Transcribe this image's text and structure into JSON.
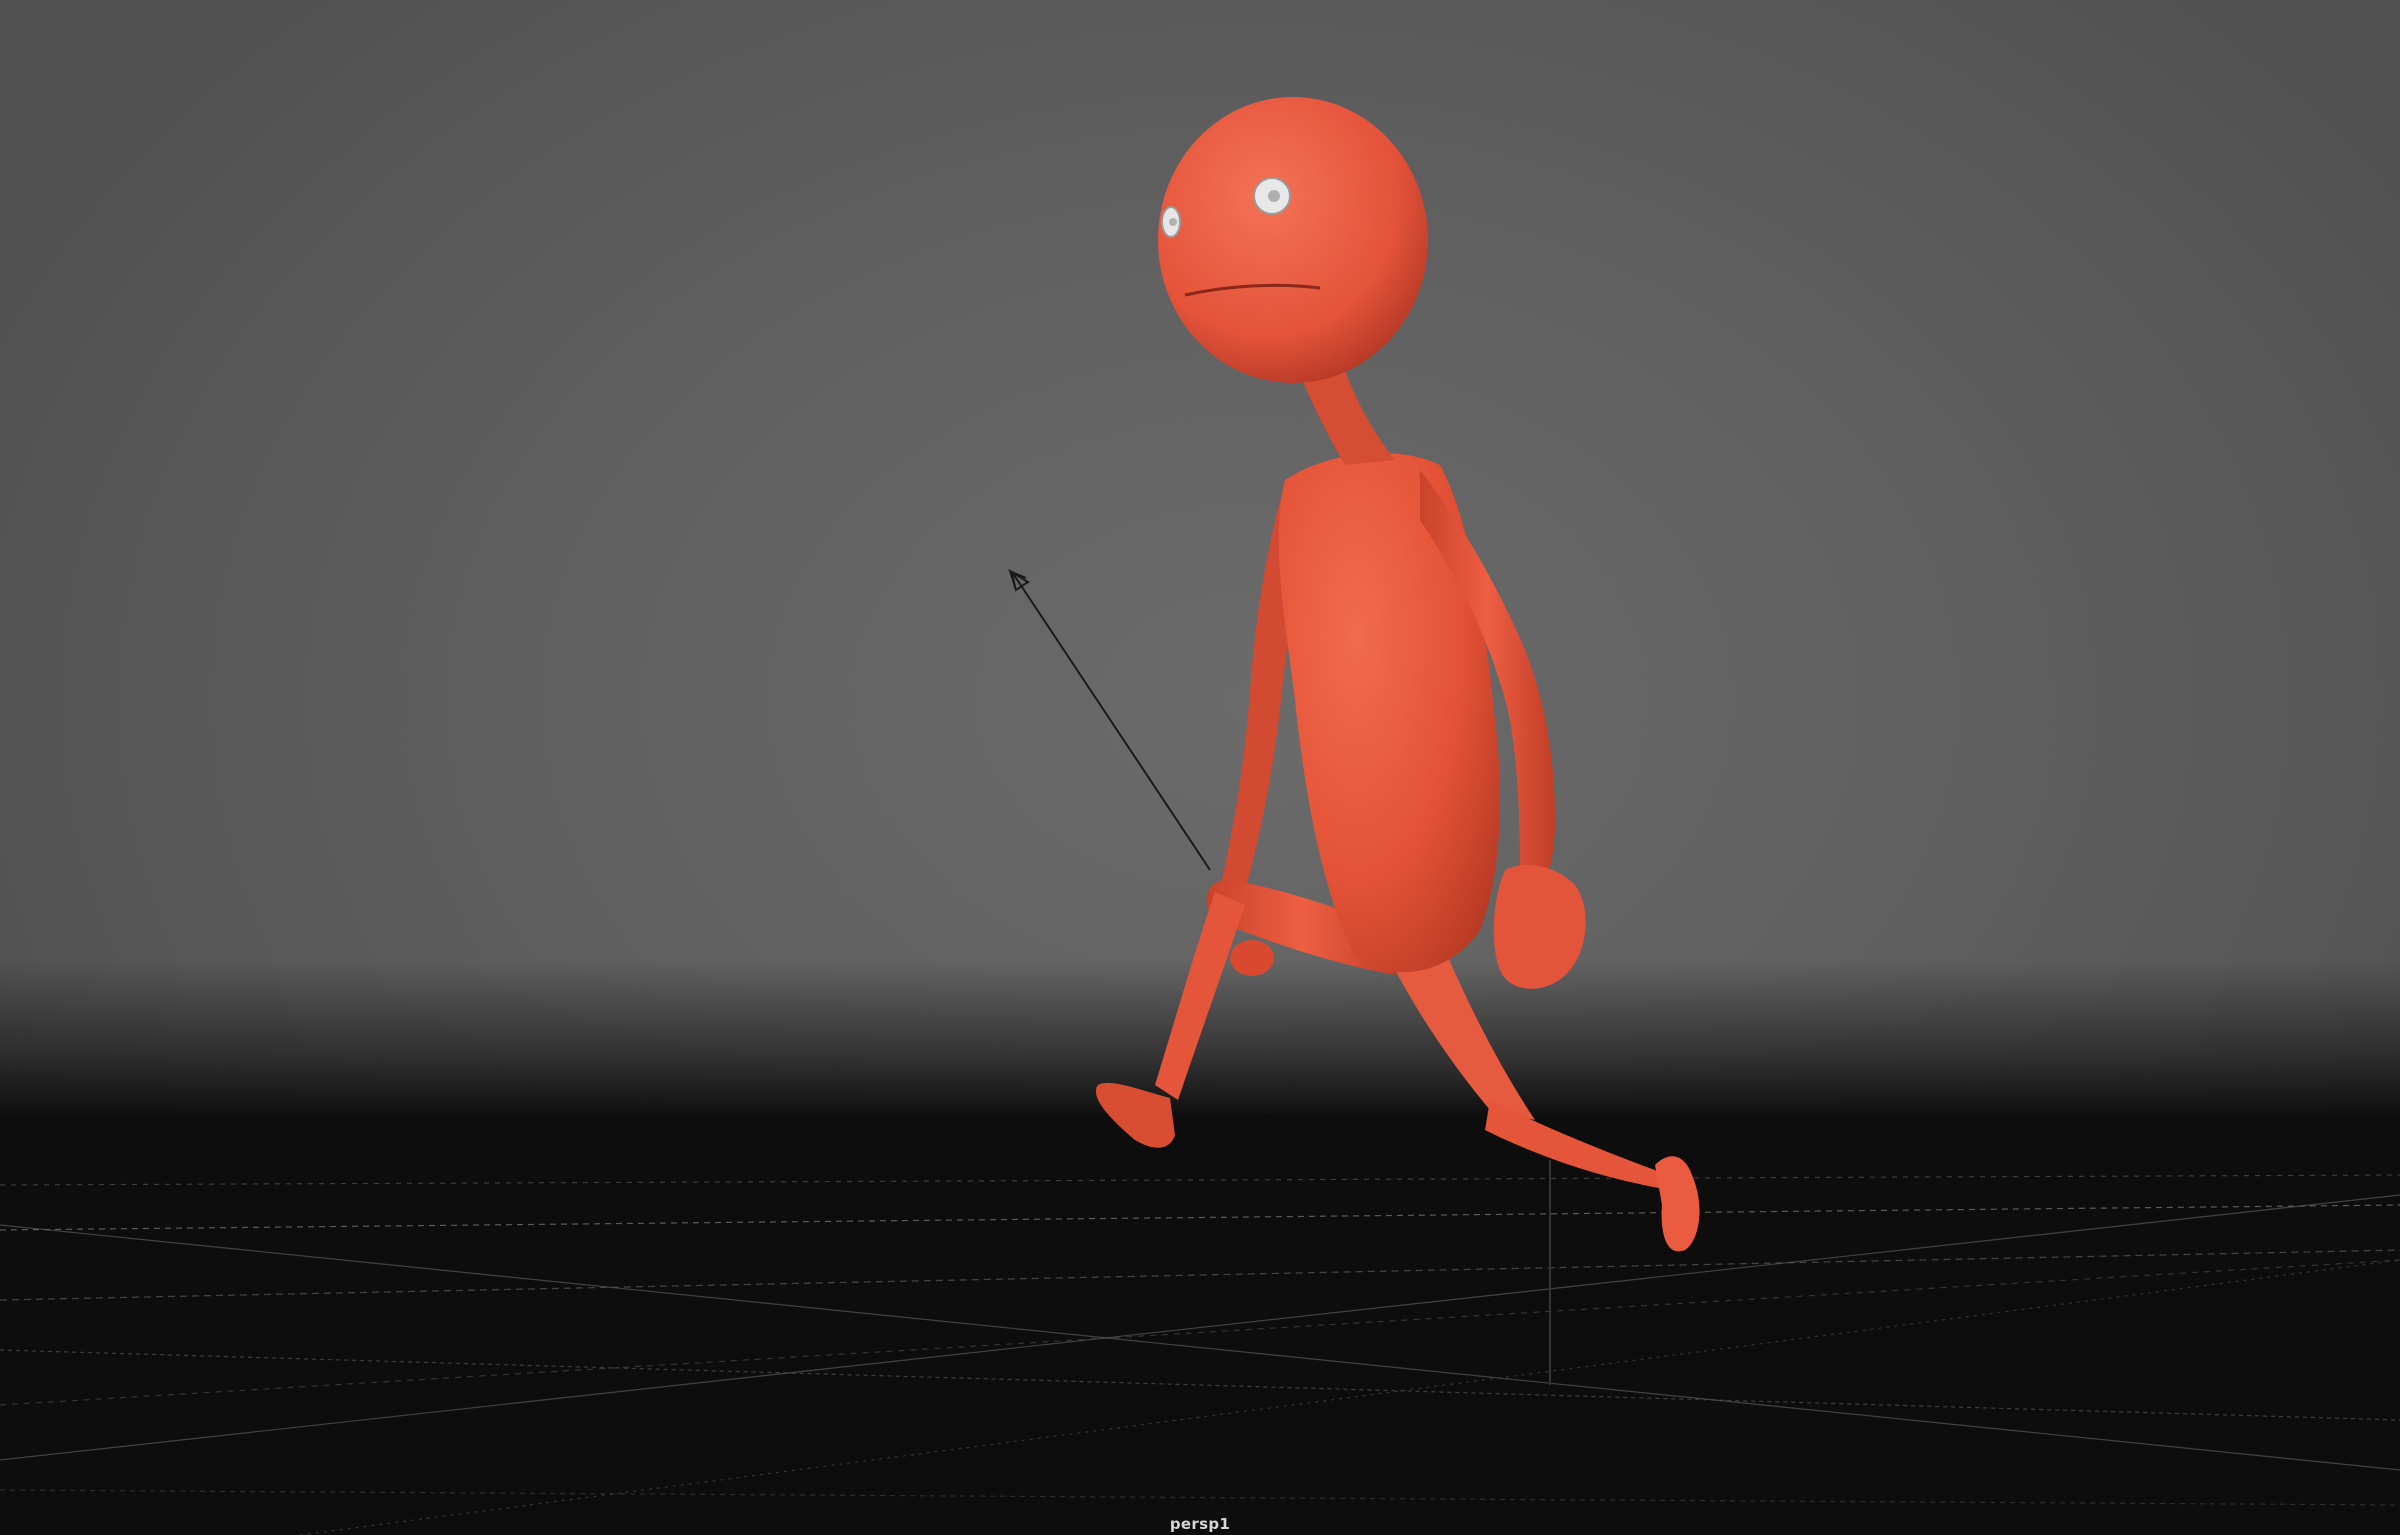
{
  "viewport": {
    "camera_name": "persp1",
    "shading": "smooth-shaded",
    "character_color": "#e8543a",
    "background_color": "#606060",
    "floor_color": "#0d0d0d",
    "grid_color": "#6a6a6a"
  },
  "scene": {
    "character": "walking-figure",
    "manipulator": "arrow-handle-icon",
    "grid": "ground-grid"
  }
}
